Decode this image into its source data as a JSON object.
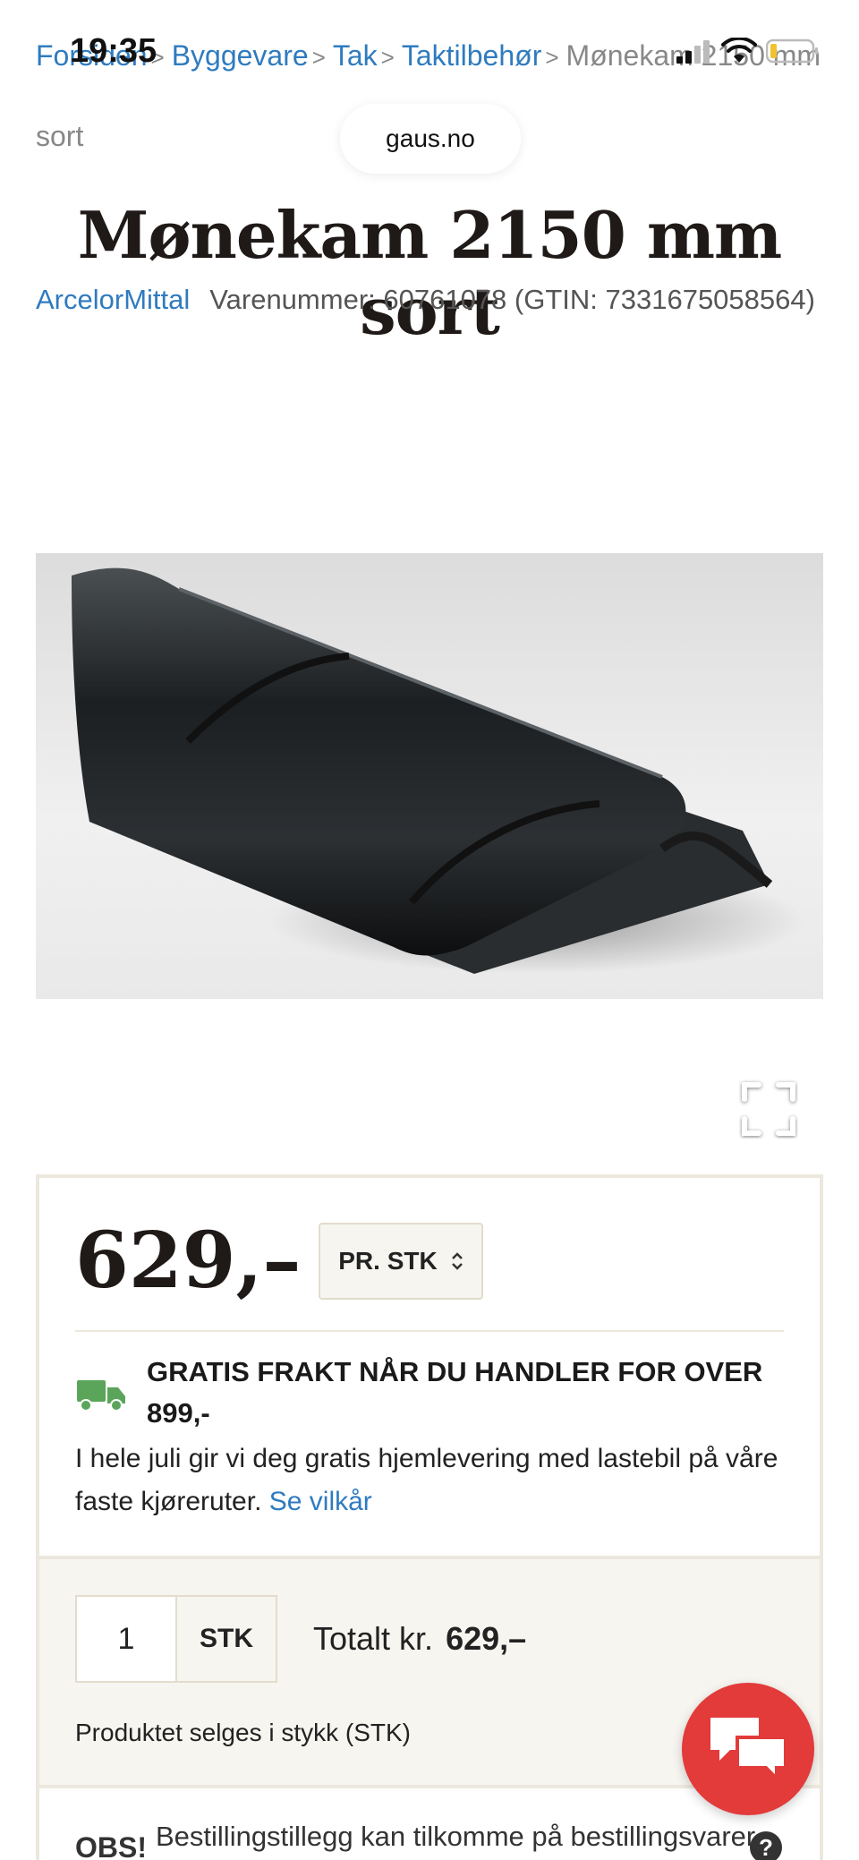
{
  "status_bar": {
    "time": "19:35"
  },
  "browser": {
    "url": "gaus.no"
  },
  "breadcrumb": {
    "items": [
      "Forsiden",
      "Byggevare",
      "Tak",
      "Taktilbehør"
    ],
    "current": "Mønekam 2150 mm sort"
  },
  "product": {
    "title": "Mønekam 2150 mm sort",
    "brand": "ArcelorMittal",
    "item_number": "Varenummer: 60761078 (GTIN: 7331675058564)"
  },
  "pricing": {
    "price": "629,–",
    "unit_select": "PR. STK"
  },
  "shipping": {
    "headline": "GRATIS FRAKT NÅR DU HANDLER FOR OVER 899,-",
    "body": "I hele juli gir vi deg gratis hjemlevering med lastebil på våre faste kjøreruter.",
    "link": "Se vilkår"
  },
  "quantity": {
    "value": "1",
    "unit": "STK",
    "total_label": "Totalt kr.",
    "total_amount": "629,–",
    "note": "Produktet selges i stykk (STK)"
  },
  "obs": {
    "label": "OBS!",
    "text": "Bestillingstillegg kan tilkomme på bestillingsvarer"
  },
  "icons": {
    "truck": "truck-icon",
    "fullscreen": "fullscreen-icon",
    "chat": "chat-icon",
    "help": "help-icon"
  },
  "colors": {
    "link": "#2f7bbf",
    "truck": "#5aa55a",
    "chat_button": "#e33a3a",
    "box_border": "#ece8dd"
  }
}
